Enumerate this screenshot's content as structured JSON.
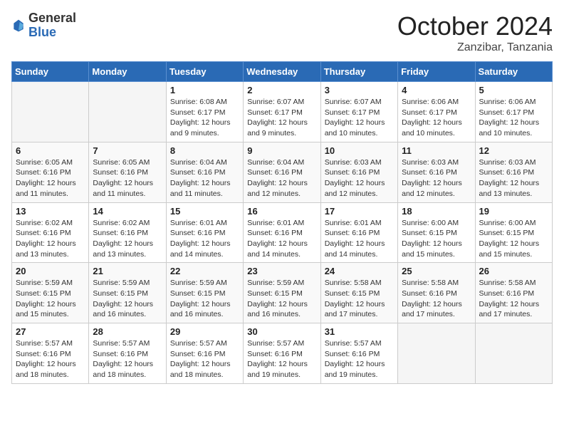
{
  "header": {
    "logo_general": "General",
    "logo_blue": "Blue",
    "month": "October 2024",
    "location": "Zanzibar, Tanzania"
  },
  "days_of_week": [
    "Sunday",
    "Monday",
    "Tuesday",
    "Wednesday",
    "Thursday",
    "Friday",
    "Saturday"
  ],
  "weeks": [
    [
      {
        "day": "",
        "info": ""
      },
      {
        "day": "",
        "info": ""
      },
      {
        "day": "1",
        "sunrise": "6:08 AM",
        "sunset": "6:17 PM",
        "daylight": "12 hours and 9 minutes."
      },
      {
        "day": "2",
        "sunrise": "6:07 AM",
        "sunset": "6:17 PM",
        "daylight": "12 hours and 9 minutes."
      },
      {
        "day": "3",
        "sunrise": "6:07 AM",
        "sunset": "6:17 PM",
        "daylight": "12 hours and 10 minutes."
      },
      {
        "day": "4",
        "sunrise": "6:06 AM",
        "sunset": "6:17 PM",
        "daylight": "12 hours and 10 minutes."
      },
      {
        "day": "5",
        "sunrise": "6:06 AM",
        "sunset": "6:17 PM",
        "daylight": "12 hours and 10 minutes."
      }
    ],
    [
      {
        "day": "6",
        "sunrise": "6:05 AM",
        "sunset": "6:16 PM",
        "daylight": "12 hours and 11 minutes."
      },
      {
        "day": "7",
        "sunrise": "6:05 AM",
        "sunset": "6:16 PM",
        "daylight": "12 hours and 11 minutes."
      },
      {
        "day": "8",
        "sunrise": "6:04 AM",
        "sunset": "6:16 PM",
        "daylight": "12 hours and 11 minutes."
      },
      {
        "day": "9",
        "sunrise": "6:04 AM",
        "sunset": "6:16 PM",
        "daylight": "12 hours and 12 minutes."
      },
      {
        "day": "10",
        "sunrise": "6:03 AM",
        "sunset": "6:16 PM",
        "daylight": "12 hours and 12 minutes."
      },
      {
        "day": "11",
        "sunrise": "6:03 AM",
        "sunset": "6:16 PM",
        "daylight": "12 hours and 12 minutes."
      },
      {
        "day": "12",
        "sunrise": "6:03 AM",
        "sunset": "6:16 PM",
        "daylight": "12 hours and 13 minutes."
      }
    ],
    [
      {
        "day": "13",
        "sunrise": "6:02 AM",
        "sunset": "6:16 PM",
        "daylight": "12 hours and 13 minutes."
      },
      {
        "day": "14",
        "sunrise": "6:02 AM",
        "sunset": "6:16 PM",
        "daylight": "12 hours and 13 minutes."
      },
      {
        "day": "15",
        "sunrise": "6:01 AM",
        "sunset": "6:16 PM",
        "daylight": "12 hours and 14 minutes."
      },
      {
        "day": "16",
        "sunrise": "6:01 AM",
        "sunset": "6:16 PM",
        "daylight": "12 hours and 14 minutes."
      },
      {
        "day": "17",
        "sunrise": "6:01 AM",
        "sunset": "6:16 PM",
        "daylight": "12 hours and 14 minutes."
      },
      {
        "day": "18",
        "sunrise": "6:00 AM",
        "sunset": "6:15 PM",
        "daylight": "12 hours and 15 minutes."
      },
      {
        "day": "19",
        "sunrise": "6:00 AM",
        "sunset": "6:15 PM",
        "daylight": "12 hours and 15 minutes."
      }
    ],
    [
      {
        "day": "20",
        "sunrise": "5:59 AM",
        "sunset": "6:15 PM",
        "daylight": "12 hours and 15 minutes."
      },
      {
        "day": "21",
        "sunrise": "5:59 AM",
        "sunset": "6:15 PM",
        "daylight": "12 hours and 16 minutes."
      },
      {
        "day": "22",
        "sunrise": "5:59 AM",
        "sunset": "6:15 PM",
        "daylight": "12 hours and 16 minutes."
      },
      {
        "day": "23",
        "sunrise": "5:59 AM",
        "sunset": "6:15 PM",
        "daylight": "12 hours and 16 minutes."
      },
      {
        "day": "24",
        "sunrise": "5:58 AM",
        "sunset": "6:15 PM",
        "daylight": "12 hours and 17 minutes."
      },
      {
        "day": "25",
        "sunrise": "5:58 AM",
        "sunset": "6:16 PM",
        "daylight": "12 hours and 17 minutes."
      },
      {
        "day": "26",
        "sunrise": "5:58 AM",
        "sunset": "6:16 PM",
        "daylight": "12 hours and 17 minutes."
      }
    ],
    [
      {
        "day": "27",
        "sunrise": "5:57 AM",
        "sunset": "6:16 PM",
        "daylight": "12 hours and 18 minutes."
      },
      {
        "day": "28",
        "sunrise": "5:57 AM",
        "sunset": "6:16 PM",
        "daylight": "12 hours and 18 minutes."
      },
      {
        "day": "29",
        "sunrise": "5:57 AM",
        "sunset": "6:16 PM",
        "daylight": "12 hours and 18 minutes."
      },
      {
        "day": "30",
        "sunrise": "5:57 AM",
        "sunset": "6:16 PM",
        "daylight": "12 hours and 19 minutes."
      },
      {
        "day": "31",
        "sunrise": "5:57 AM",
        "sunset": "6:16 PM",
        "daylight": "12 hours and 19 minutes."
      },
      {
        "day": "",
        "info": ""
      },
      {
        "day": "",
        "info": ""
      }
    ]
  ]
}
